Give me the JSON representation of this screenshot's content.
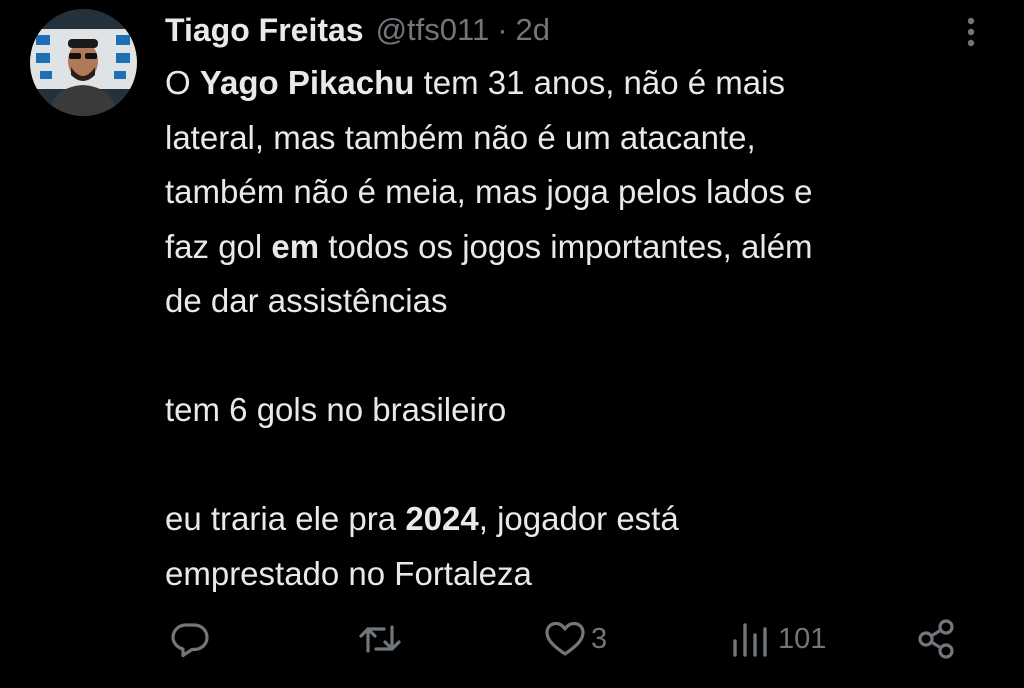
{
  "tweet": {
    "author_name": "Tiago Freitas",
    "handle": "@tfs011",
    "separator": "·",
    "time": "2d",
    "line1_pre": "O ",
    "line1_bold": "Yago Pikachu",
    "line1_post": " tem 31 anos, não é mais",
    "line2": "lateral, mas também não é um atacante,",
    "line3": "também não é meia, mas joga pelos lados e",
    "line4_pre": "faz gol ",
    "line4_bold": "em",
    "line4_post": " todos os jogos importantes, além",
    "line5": "de dar assistências",
    "line6": "tem 6 gols no brasileiro",
    "line7_pre": "eu traria ele pra ",
    "line7_bold": "2024",
    "line7_post": ", jogador está",
    "line8": "emprestado no Fortaleza"
  },
  "actions": {
    "like_count": "3",
    "views_count": "101"
  },
  "icons": [
    "more-icon",
    "reply-icon",
    "retweet-icon",
    "like-icon",
    "views-icon",
    "share-icon"
  ],
  "colors": {
    "background": "#000000",
    "text": "#e7e9ea",
    "muted": "#71767b"
  }
}
